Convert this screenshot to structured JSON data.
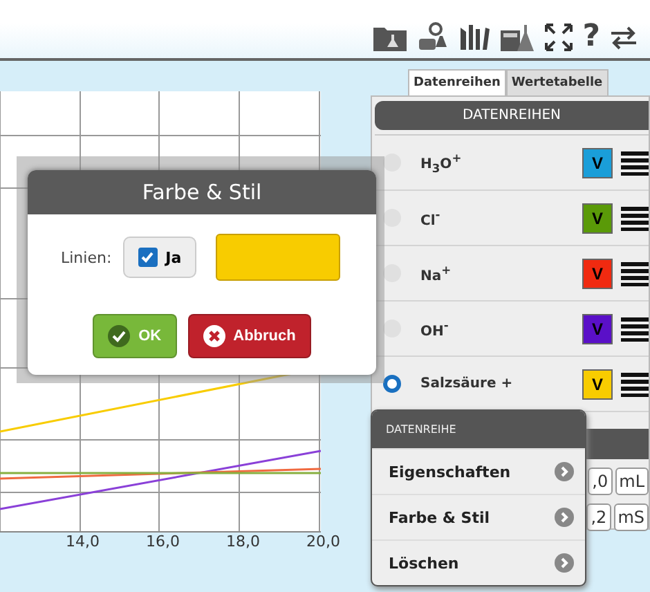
{
  "toolbar": {
    "help": "?"
  },
  "tabs": [
    {
      "label": "Datenreihen",
      "selected": true
    },
    {
      "label": "Wertetabelle",
      "selected": false
    }
  ],
  "series_panel": {
    "title": "DATENREIHEN",
    "rows": [
      {
        "label": "H$_{3}$O$^{+}$",
        "selected": false,
        "color": "#1a9ed9",
        "button": "V"
      },
      {
        "label": "Cl$^{-}$",
        "selected": false,
        "color": "#5a9a08",
        "button": "V"
      },
      {
        "label": "Na$^{+}$",
        "selected": false,
        "color": "#f02a10",
        "button": "V"
      },
      {
        "label": "OH$^{-}$",
        "selected": false,
        "color": "#5a10c8",
        "button": "V"
      },
      {
        "label": "Salzsäure +",
        "selected": true,
        "color": "#f8cc00",
        "button": "V"
      }
    ]
  },
  "value_fields": [
    {
      "value": ",0",
      "unit": "mL"
    },
    {
      "value": ",2",
      "unit": "mS"
    }
  ],
  "chart": {
    "x_labels": [
      "14,0",
      "16,0",
      "18,0",
      "20,0"
    ]
  },
  "dialog": {
    "title": "Farbe & Stil",
    "field_label": "Linien:",
    "checkbox": {
      "label": "Ja",
      "checked": true
    },
    "ok": "OK",
    "cancel": "Abbruch"
  },
  "context_menu": {
    "title": "DATENREIHE",
    "items": [
      "Eigenschaften",
      "Farbe & Stil",
      "Löschen"
    ]
  }
}
